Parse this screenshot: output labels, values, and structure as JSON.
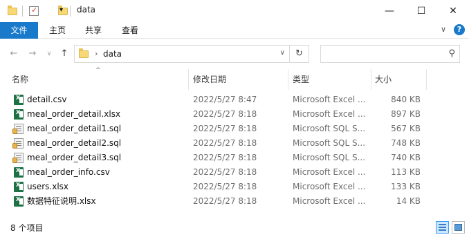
{
  "window": {
    "title": "data",
    "minimize_glyph": "—",
    "maximize_glyph": "☐",
    "close_glyph": "✕",
    "qa_dropdown_glyph": "▾"
  },
  "ribbon": {
    "tabs": [
      {
        "label": "文件",
        "active": true
      },
      {
        "label": "主页",
        "active": false
      },
      {
        "label": "共享",
        "active": false
      },
      {
        "label": "查看",
        "active": false
      }
    ],
    "collapse_glyph": "∨",
    "help_glyph": "?"
  },
  "nav": {
    "back_glyph": "←",
    "forward_glyph": "→",
    "recent_glyph": "∨",
    "up_glyph": "↑",
    "path_chevron": "›",
    "path": "data",
    "address_dropdown": "∨",
    "refresh_glyph": "↻",
    "search_placeholder": "",
    "search_glyph": "⚲"
  },
  "columns": {
    "name": "名称",
    "date": "修改日期",
    "type": "类型",
    "size": "大小",
    "sort_glyph": "^"
  },
  "files": [
    {
      "name": "detail.csv",
      "date": "2022/5/27 8:47",
      "type": "Microsoft Excel ...",
      "size": "840 KB",
      "icon": "excel-icon"
    },
    {
      "name": "meal_order_detail.xlsx",
      "date": "2022/5/27 8:18",
      "type": "Microsoft Excel ...",
      "size": "897 KB",
      "icon": "excel-icon"
    },
    {
      "name": "meal_order_detail1.sql",
      "date": "2022/5/27 8:18",
      "type": "Microsoft SQL S...",
      "size": "567 KB",
      "icon": "sql-file-icon"
    },
    {
      "name": "meal_order_detail2.sql",
      "date": "2022/5/27 8:18",
      "type": "Microsoft SQL S...",
      "size": "748 KB",
      "icon": "sql-file-icon"
    },
    {
      "name": "meal_order_detail3.sql",
      "date": "2022/5/27 8:18",
      "type": "Microsoft SQL S...",
      "size": "740 KB",
      "icon": "sql-file-icon"
    },
    {
      "name": "meal_order_info.csv",
      "date": "2022/5/27 8:18",
      "type": "Microsoft Excel ...",
      "size": "113 KB",
      "icon": "excel-icon"
    },
    {
      "name": "users.xlsx",
      "date": "2022/5/27 8:18",
      "type": "Microsoft Excel ...",
      "size": "133 KB",
      "icon": "excel-icon"
    },
    {
      "name": "数据特征说明.xlsx",
      "date": "2022/5/27 8:18",
      "type": "Microsoft Excel ...",
      "size": "14 KB",
      "icon": "excel-icon"
    }
  ],
  "status": {
    "item_count": "8 个项目"
  },
  "colors": {
    "accent": "#1979ca",
    "excel_green": "#1e7145",
    "folder_yellow": "#f8d775"
  }
}
